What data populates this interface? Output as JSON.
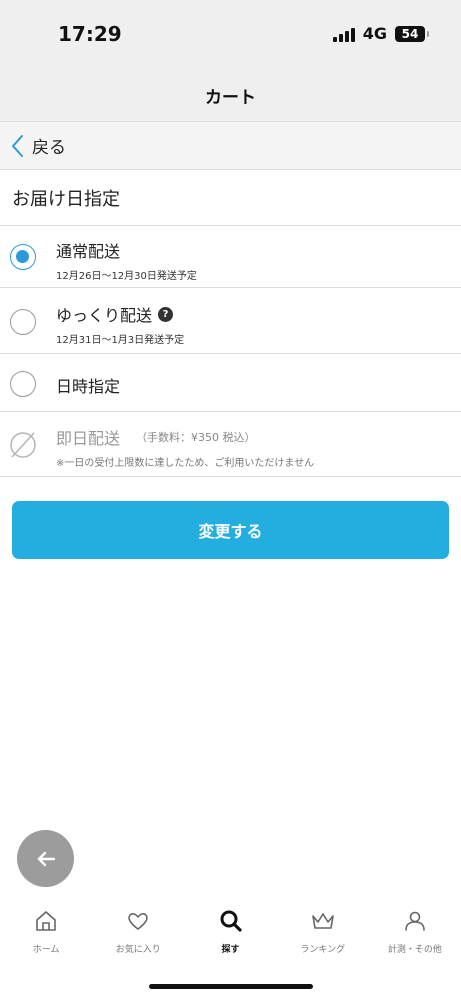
{
  "status_bar": {
    "time": "17:29",
    "network": "4G",
    "battery": "54"
  },
  "header": {
    "title": "カート"
  },
  "back": {
    "label": "戻る"
  },
  "section": {
    "title": "お届け日指定"
  },
  "options": [
    {
      "label": "通常配送",
      "sub": "12月26日〜12月30日発送予定",
      "selected": true
    },
    {
      "label": "ゆっくり配送",
      "help_icon": "?",
      "sub": "12月31日〜1月3日発送予定",
      "selected": false
    },
    {
      "label": "日時指定",
      "selected": false
    },
    {
      "label": "即日配送",
      "fee": "（手数料：¥350 税込）",
      "sub": "※一日の受付上限数に達したため、ご利用いただけません",
      "disabled": true
    }
  ],
  "submit": {
    "label": "変更する"
  },
  "colors": {
    "accent": "#24aee0",
    "radio": "#2c9ad9",
    "header_bg": "#efefef"
  },
  "tabs": [
    {
      "label": "ホーム",
      "icon": "home-icon"
    },
    {
      "label": "お気に入り",
      "icon": "heart-icon"
    },
    {
      "label": "探す",
      "icon": "search-icon",
      "active": true
    },
    {
      "label": "ランキング",
      "icon": "crown-icon"
    },
    {
      "label": "計測・その他",
      "icon": "person-icon"
    }
  ]
}
